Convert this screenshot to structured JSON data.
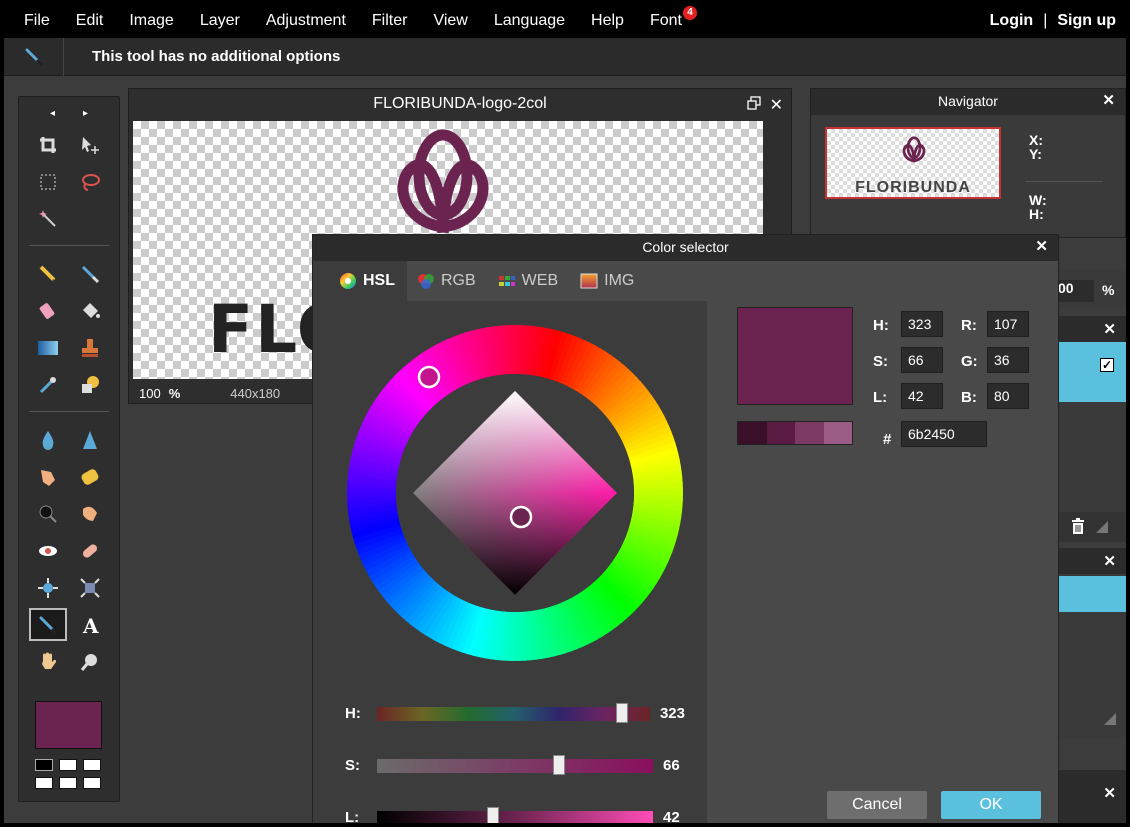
{
  "menu": {
    "items": [
      "File",
      "Edit",
      "Image",
      "Layer",
      "Adjustment",
      "Filter",
      "View",
      "Language",
      "Help",
      "Font"
    ],
    "font_badge": "4",
    "login": "Login",
    "separator": "|",
    "signup": "Sign up"
  },
  "options_bar": {
    "text": "This tool has no additional options"
  },
  "tools": {
    "prev": "◂",
    "next": "▸",
    "active_tool": "color-picker",
    "foreground_color": "#6b2450"
  },
  "document": {
    "title": "FLORIBUNDA-logo-2col",
    "canvas_text": "FLO",
    "zoom": "100",
    "zoom_unit": "%",
    "size": "440x180"
  },
  "navigator": {
    "title": "Navigator",
    "thumb_text": "FLORIBUNDA",
    "x_label": "X:",
    "y_label": "Y:",
    "w_label": "W:",
    "h_label": "H:",
    "zoom_partial": "00",
    "zoom_unit": "%"
  },
  "color_selector": {
    "title": "Color selector",
    "tabs": [
      {
        "label": "HSL",
        "active": true
      },
      {
        "label": "RGB",
        "active": false
      },
      {
        "label": "WEB",
        "active": false
      },
      {
        "label": "IMG",
        "active": false
      }
    ],
    "hue_wheel_marker_color": "#c41590",
    "diamond_marker_color": "#6b2450",
    "sliders": [
      {
        "label": "H:",
        "value": "323",
        "fraction": 0.897
      },
      {
        "label": "S:",
        "value": "66",
        "fraction": 0.66
      },
      {
        "label": "L:",
        "value": "42",
        "fraction": 0.42
      }
    ],
    "preview_color": "#6b2450",
    "shades": [
      "#3a0f2a",
      "#5a1c42",
      "#7c3a63",
      "#9a5b85"
    ],
    "fields": {
      "h_label": "H:",
      "h": "323",
      "s_label": "S:",
      "s": "66",
      "l_label": "L:",
      "l": "42",
      "r_label": "R:",
      "r": "107",
      "g_label": "G:",
      "g": "36",
      "b_label": "B:",
      "b": "80",
      "hex_label": "#",
      "hex": "6b2450"
    },
    "cancel_label": "Cancel",
    "ok_label": "OK"
  },
  "colors": {
    "accent": "#5bc0de",
    "selected": "#6b2450"
  }
}
